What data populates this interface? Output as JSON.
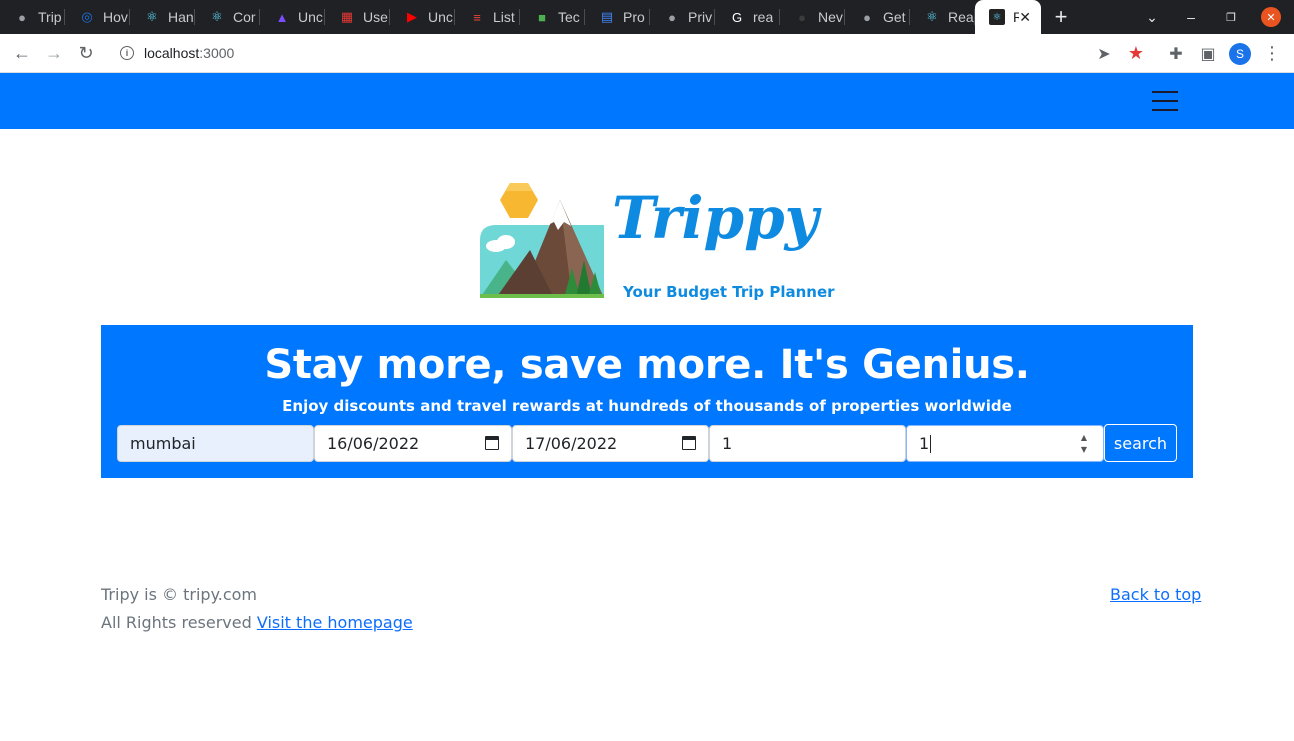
{
  "browser": {
    "tabs": [
      {
        "title": "Trip",
        "icon": "globe-icon",
        "color": "#9aa0a6"
      },
      {
        "title": "Hov",
        "icon": "loop-icon",
        "color": "#1a73e8"
      },
      {
        "title": "Han",
        "icon": "react-icon",
        "color": "#61dafb"
      },
      {
        "title": "Cor",
        "icon": "react-icon",
        "color": "#61dafb"
      },
      {
        "title": "Unc",
        "icon": "rocket-icon",
        "color": "#7c4dff"
      },
      {
        "title": "Use",
        "icon": "grid-icon",
        "color": "#e53935"
      },
      {
        "title": "Unc",
        "icon": "youtube-icon",
        "color": "#ff0000"
      },
      {
        "title": "List",
        "icon": "list-icon",
        "color": "#e8453c"
      },
      {
        "title": "Tec",
        "icon": "cube-icon",
        "color": "#4caf50"
      },
      {
        "title": "Pro",
        "icon": "doc-icon",
        "color": "#4285f4"
      },
      {
        "title": "Priv",
        "icon": "globe-icon",
        "color": "#9aa0a6"
      },
      {
        "title": "rea",
        "icon": "google-icon",
        "color": "#ffffff"
      },
      {
        "title": "Nev",
        "icon": "github-icon",
        "color": "#3c3c3c"
      },
      {
        "title": "Get",
        "icon": "globe-icon",
        "color": "#9aa0a6"
      },
      {
        "title": "Rea",
        "icon": "react-icon",
        "color": "#61dafb"
      }
    ],
    "active_tab": {
      "title": "R",
      "icon": "react-icon"
    },
    "url_host": "localhost",
    "url_port": ":3000"
  },
  "hero": {
    "headline": "Stay more, save more. It's Genius.",
    "subline": "Enjoy discounts and travel rewards at hundreds of thousands of properties worldwide"
  },
  "search": {
    "destination": "mumbai",
    "checkin": "16/06/2022",
    "checkout": "17/06/2022",
    "guests": "1",
    "rooms": "1",
    "button_label": "search"
  },
  "logo": {
    "name": "Trippy",
    "tagline": "Your Budget Trip Planner"
  },
  "footer": {
    "copyright": "Tripy is © tripy.com",
    "rights": "All Rights reserved ",
    "homepage_link": "Visit the homepage",
    "back_to_top": "Back to top"
  },
  "colors": {
    "brand": "#0077ff",
    "link": "#0d6efd"
  }
}
